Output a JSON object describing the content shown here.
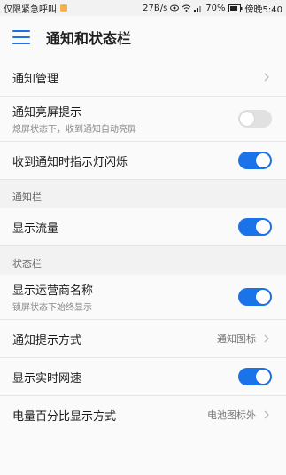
{
  "status_bar": {
    "carrier": "仅限紧急呼叫",
    "net_speed": "27B/s",
    "battery": "70%",
    "time": "傍晚5:40"
  },
  "header": {
    "title": "通知和状态栏"
  },
  "rows": {
    "notification_management": {
      "label": "通知管理"
    },
    "wake_on_notification": {
      "label": "通知亮屏提示",
      "sub": "熄屏状态下，收到通知自动亮屏",
      "toggle": false
    },
    "blink_light": {
      "label": "收到通知时指示灯闪烁",
      "toggle": true
    }
  },
  "section_notification_bar": {
    "title": "通知栏"
  },
  "show_traffic": {
    "label": "显示流量",
    "toggle": true
  },
  "section_status_bar": {
    "title": "状态栏"
  },
  "show_carrier": {
    "label": "显示运营商名称",
    "sub": "锁屏状态下始终显示",
    "toggle": true
  },
  "notification_style": {
    "label": "通知提示方式",
    "value": "通知图标"
  },
  "realtime_speed": {
    "label": "显示实时网速",
    "toggle": true
  },
  "battery_percent": {
    "label": "电量百分比显示方式",
    "value": "电池图标外"
  },
  "colors": {
    "accent": "#1a73e8",
    "toggle_off": "#e1e1e1",
    "section_bg": "#f2f2f2"
  }
}
